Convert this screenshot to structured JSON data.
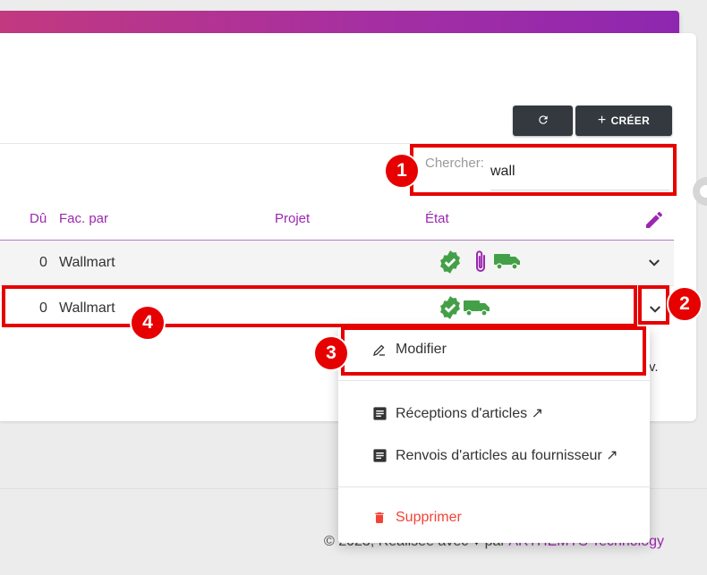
{
  "toolbar": {
    "refresh_icon": "refresh-icon",
    "create_label": "CRÉER",
    "create_icon": "+"
  },
  "search": {
    "label": "Chercher:",
    "value": "wall"
  },
  "table": {
    "columns": [
      "Dû",
      "Fac. par",
      "Projet",
      "État"
    ],
    "edit_icon": "pencil-icon",
    "rows": [
      {
        "due": "0",
        "billed_by": "Wallmart",
        "status_icons": [
          "verified-badge-icon",
          "paperclip-icon",
          "truck-icon"
        ]
      },
      {
        "due": "0",
        "billed_by": "Wallmart",
        "status_icons": [
          "verified-badge-icon",
          "truck-icon"
        ]
      }
    ]
  },
  "menu": {
    "items": [
      {
        "label": "Modifier",
        "icon": "edit-pen-icon"
      },
      {
        "label": "Réceptions d'articles ↗",
        "icon": "document-icon"
      },
      {
        "label": "Renvois d'articles au fournisseur ↗",
        "icon": "document-icon"
      },
      {
        "label": "Supprimer",
        "icon": "trash-icon",
        "color": "#f44336"
      }
    ]
  },
  "annotations": [
    "1",
    "2",
    "3",
    "4"
  ],
  "partial_text": "v.",
  "footer": {
    "prefix": "© 2023, Réalisée avec",
    "heart": "♥",
    "by": "par",
    "company": "ARTHEMYS Technology"
  },
  "colors": {
    "accent": "#9c27b0",
    "status_green": "#4caf50",
    "annotation_red": "#e60000",
    "danger": "#f44336"
  }
}
